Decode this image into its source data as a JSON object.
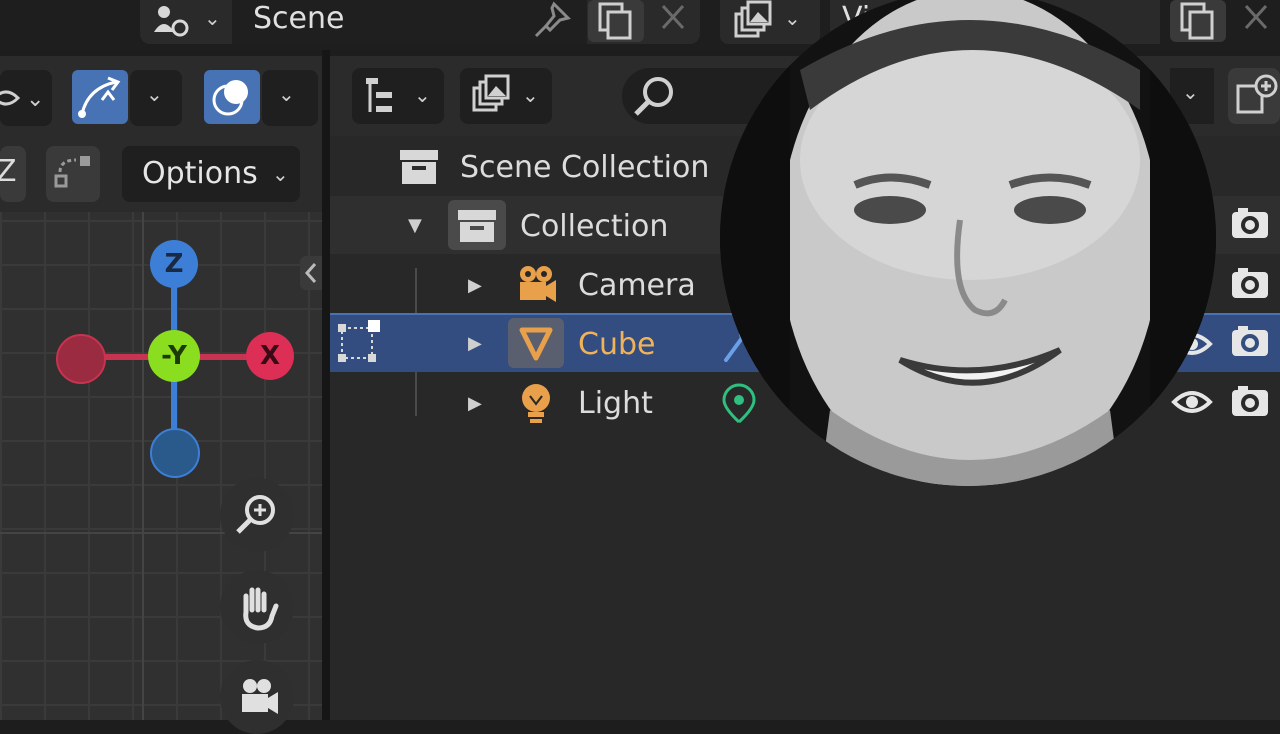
{
  "topbar": {
    "scene_label": "Scene",
    "view_layer_label": "Vi"
  },
  "viewport": {
    "axis_z_short": "Z",
    "options_label": "Options",
    "gizmo": {
      "z_label": "Z",
      "neg_y_label": "-Y",
      "x_label": "X"
    },
    "nav_icons": [
      "zoom-in-icon",
      "hand-pan-icon",
      "camera-view-icon"
    ]
  },
  "outliner": {
    "scene_collection": "Scene Collection",
    "collection": "Collection",
    "items": [
      {
        "label": "Camera",
        "icon": "camera-object-icon",
        "selected": false
      },
      {
        "label": "Cube",
        "icon": "mesh-object-icon",
        "selected": true
      },
      {
        "label": "Light",
        "icon": "light-object-icon",
        "selected": false
      }
    ]
  },
  "colors": {
    "accent_blue": "#4772b3",
    "selection_row": "#334d80",
    "object_orange": "#e8a04a",
    "axis_x_red": "#dd2e56",
    "axis_y_green": "#8bdd1f",
    "axis_z_blue": "#3d7fd6"
  }
}
